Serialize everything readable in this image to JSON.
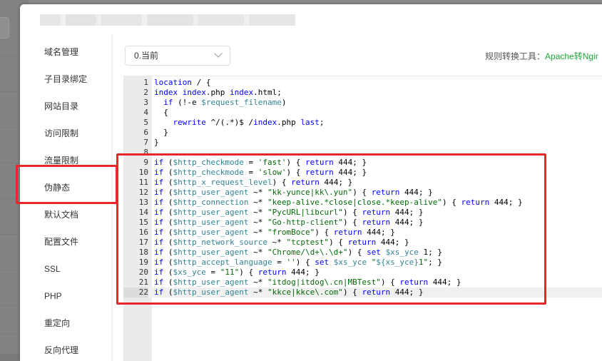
{
  "sidebar": {
    "items": [
      {
        "label": "域名管理"
      },
      {
        "label": "子目录绑定"
      },
      {
        "label": "网站目录"
      },
      {
        "label": "访问限制"
      },
      {
        "label": "流量限制"
      },
      {
        "label": "伪静态"
      },
      {
        "label": "默认文档"
      },
      {
        "label": "配置文件"
      },
      {
        "label": "SSL"
      },
      {
        "label": "PHP"
      },
      {
        "label": "重定向"
      },
      {
        "label": "反向代理"
      }
    ],
    "active": "伪静态"
  },
  "toolbar": {
    "template_select": "0.当前",
    "converter_label": "规则转换工具：",
    "converter_link": "Apache转Ngir"
  },
  "editor": {
    "current_line": 22,
    "lines": [
      "location / {",
      "index index.php index.html;",
      "  if (!-e $request_filename)",
      "  {",
      "    rewrite ^/(.*)$ /index.php last;",
      "  }",
      "}",
      "",
      "if ($http_checkmode = 'fast') { return 444; }",
      "if ($http_checkmode = 'slow') { return 444; }",
      "if ($http_x_request_level) { return 444; }",
      "if ($http_user_agent ~* \"kk-yunce|kk\\.yun\") { return 444; }",
      "if ($http_connection ~* \"keep-alive.*close|close.*keep-alive\") { return 444; }",
      "if ($http_user_agent ~* \"PycURL|libcurl\") { return 444; }",
      "if ($http_user_agent ~* \"Go-http-client\") { return 444; }",
      "if ($http_user_agent ~* \"fromBoce\") { return 444; }",
      "if ($http_network_source ~* \"tcptest\") { return 444; }",
      "if ($http_user_agent ~* \"Chrome/\\d+\\.\\d+\") { set $xs_yce 1; }",
      "if ($http_accept_language = '') { set $xs_yce \"${xs_yce}1\"; }",
      "if ($xs_yce = \"11\") { return 444; }",
      "if ($http_user_agent ~* \"itdog|itdog\\.cn|MBTest\") { return 444; }",
      "if ($http_user_agent ~* \"kkce|kkce\\.com\") { return 444; }"
    ]
  },
  "colors": {
    "accent_green": "#20a53a",
    "highlight_red": "#e8262b",
    "keyword_blue": "#0000ff",
    "variable_teal": "#318495",
    "string_green": "#036a07"
  }
}
